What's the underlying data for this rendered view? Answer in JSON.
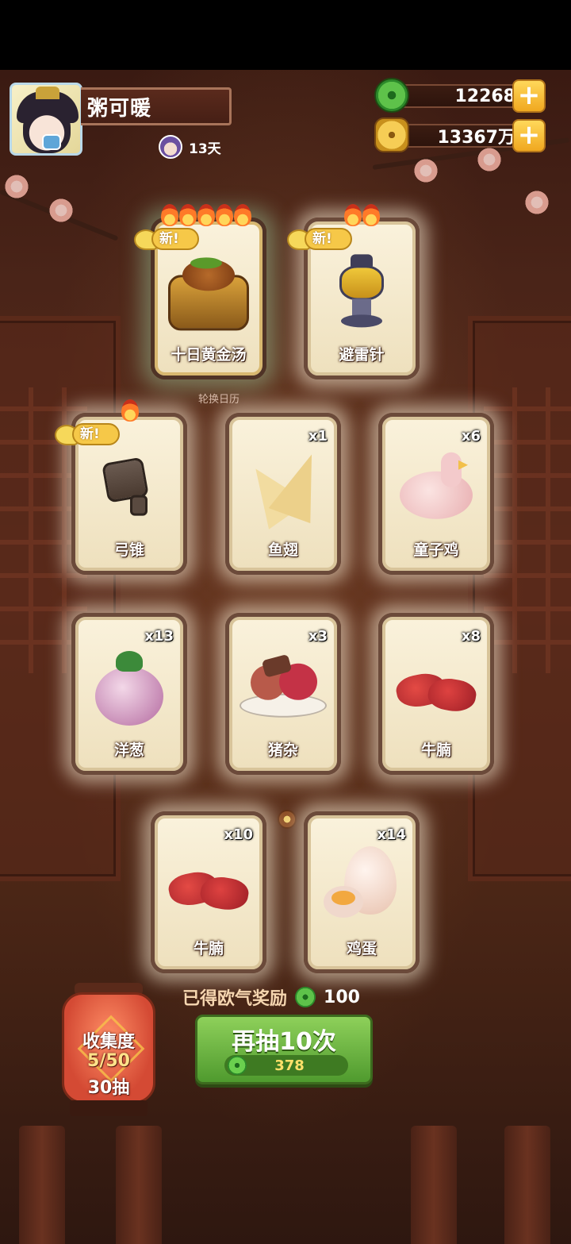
{
  "player": {
    "name": "粥可暖",
    "days": "13天"
  },
  "currency": [
    {
      "icon": "jade-coin-icon",
      "amount": "12268"
    },
    {
      "icon": "gold-coin-icon",
      "amount": "13367万"
    }
  ],
  "featured_cards": [
    {
      "label": "十日黄金汤",
      "is_new": true,
      "new_text": "新",
      "flames": 5
    },
    {
      "label": "避雷针",
      "is_new": true,
      "new_text": "新",
      "flames": 2
    }
  ],
  "rotation_label": "轮换日历",
  "cards": [
    {
      "label": "弓锥",
      "count": "",
      "is_new": true,
      "new_text": "新",
      "flames": 1
    },
    {
      "label": "鱼翅",
      "count": "x1"
    },
    {
      "label": "童子鸡",
      "count": "x6"
    },
    {
      "label": "洋葱",
      "count": "x13"
    },
    {
      "label": "猪杂",
      "count": "x3"
    },
    {
      "label": "牛腩",
      "count": "x8"
    },
    {
      "label": "牛腩",
      "count": "x10"
    },
    {
      "label": "鸡蛋",
      "count": "x14"
    }
  ],
  "collection": {
    "title": "收集度",
    "progress": "5/50",
    "pulls": "30抽"
  },
  "bonus": {
    "label": "已得欧气奖励",
    "value": "100"
  },
  "draw_button": {
    "label": "再抽10次",
    "cost": "378"
  },
  "colors": {
    "accent_green": "#5ea83a",
    "gold": "#f6c848",
    "card_bg": "#faf2dc",
    "panel_dark": "#4a2418"
  }
}
